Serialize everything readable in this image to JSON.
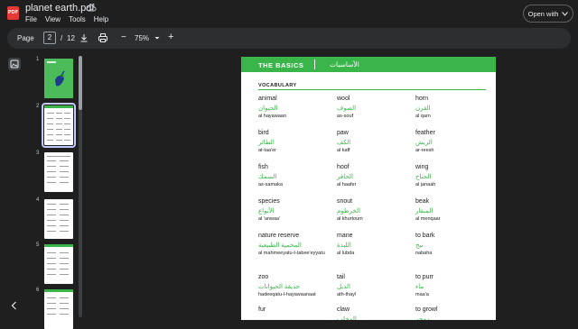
{
  "app": {
    "file_title": "planet earth.pdf",
    "icon_label": "PDF",
    "menu": [
      "File",
      "View",
      "Tools",
      "Help"
    ],
    "open_with_label": "Open with"
  },
  "toolbar": {
    "page_label": "Page",
    "current_page": "2",
    "page_sep": "/",
    "total_pages": "12",
    "zoom_minus": "−",
    "zoom": "75%",
    "zoom_plus": "+"
  },
  "thumbnails": [
    {
      "num": "1",
      "selected": false
    },
    {
      "num": "2",
      "selected": true
    },
    {
      "num": "3",
      "selected": false
    },
    {
      "num": "4",
      "selected": false
    },
    {
      "num": "5",
      "selected": false
    },
    {
      "num": "6",
      "selected": false
    }
  ],
  "page": {
    "banner_title": "THE BASICS",
    "banner_arabic": "الأساسيات",
    "section_title": "VOCABULARY",
    "columns": [
      [
        {
          "en": "animal",
          "ar": "الحيوان",
          "tr": "al hayawaan"
        },
        {
          "en": "bird",
          "ar": "الطائر",
          "tr": "at-taa'er"
        },
        {
          "en": "fish",
          "ar": "السمك",
          "tr": "as-samaka"
        },
        {
          "en": "species",
          "ar": "الأنواع",
          "tr": "al 'anwaa'"
        },
        {
          "en": "nature reserve",
          "ar": "المحمية الطبيعية",
          "tr": "al mahmeeyatu-t-tabee'eyyatu"
        },
        {
          "en": "zoo",
          "ar": "حديقة الحيوانات",
          "tr": "hadeeqatu-l-hayawaanaat"
        },
        {
          "en": "fur",
          "ar": "",
          "tr": ""
        }
      ],
      [
        {
          "en": "wool",
          "ar": "الصوف",
          "tr": "as-souf"
        },
        {
          "en": "paw",
          "ar": "الكف",
          "tr": "al kaff"
        },
        {
          "en": "hoof",
          "ar": "الحافر",
          "tr": "al haafer"
        },
        {
          "en": "snout",
          "ar": "الخرطوم",
          "tr": "al khurtoum"
        },
        {
          "en": "mane",
          "ar": "اللبدة",
          "tr": "al lubda"
        },
        {
          "en": "tail",
          "ar": "الذيل",
          "tr": "ath-thayl"
        },
        {
          "en": "claw",
          "ar": "المخلب",
          "tr": ""
        }
      ],
      [
        {
          "en": "horn",
          "ar": "القرن",
          "tr": "al qarn"
        },
        {
          "en": "feather",
          "ar": "الريش",
          "tr": "ar-reesh"
        },
        {
          "en": "wing",
          "ar": "الجناح",
          "tr": "al janaah"
        },
        {
          "en": "beak",
          "ar": "المنقار",
          "tr": "al menqaar"
        },
        {
          "en": "to bark",
          "ar": "نبح",
          "tr": "nabaha"
        },
        {
          "en": "to purr",
          "ar": "ماء",
          "tr": "maa'a"
        },
        {
          "en": "to growl",
          "ar": "زمجر",
          "tr": ""
        }
      ]
    ]
  },
  "colors": {
    "accent_green": "#39b54a",
    "background": "#1f1f1f",
    "toolbar": "#2d2e30"
  },
  "icons": [
    "pdf-app-icon",
    "cloud-sync-icon",
    "download-icon",
    "print-icon",
    "chevron-down-icon",
    "thumbnails-icon",
    "collapse-left-icon"
  ]
}
